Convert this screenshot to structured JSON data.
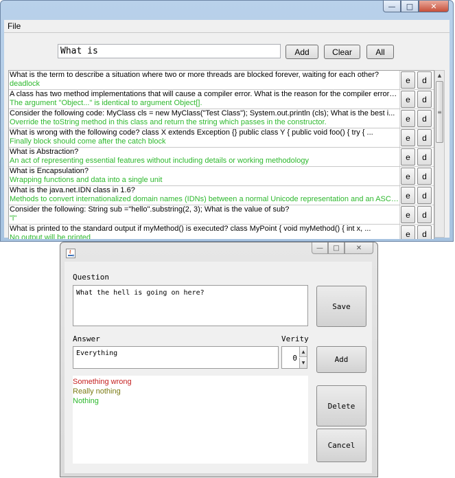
{
  "main_window": {
    "menu": {
      "file": "File"
    },
    "search": {
      "value": "What is"
    },
    "buttons": {
      "add": "Add",
      "clear": "Clear",
      "all": "All"
    },
    "row_buttons": {
      "edit": "e",
      "delete": "d"
    },
    "rows": [
      {
        "question": "What is the term to describe a situation where two or more threads are blocked forever, waiting for each other?",
        "answer": "deadlock"
      },
      {
        "question": "A class has two method implementations that will cause a compiler error. What is the reason for the compiler error? ...",
        "answer": "The argument \"Object...\" is identical to argument Object[]."
      },
      {
        "question": "Consider the following code: MyClass cls = new MyClass(\"Test Class\");  System.out.println (cls);  What is the best i...",
        "answer": "Override the toString method in this class and return the string which passes in the constructor."
      },
      {
        "question": "What is wrong with the following code?  class X extends Exception {} public class Y {     public void foo()     {     try { ...",
        "answer": "Finally block should come after the catch block"
      },
      {
        "question": "What is Abstraction?",
        "answer": "An act of representing essential features without including details or working methodology"
      },
      {
        "question": "What is Encapsulation?",
        "answer": "Wrapping functions and data into a single unit"
      },
      {
        "question": "What is the java.net.IDN class in 1.6?",
        "answer": "Methods to convert internationalized domain names (IDNs) between a normal Unicode representation and an ASCII ..."
      },
      {
        "question": " Consider the following: String sub =\"hello\".substring(2, 3); What is the value of sub?",
        "answer": "\"l\""
      },
      {
        "question": " What is printed to the standard output if myMethod() is executed?  class MyPoint {     void myMethod() {       int x, ...",
        "answer": "No output will be printed"
      }
    ]
  },
  "dialog": {
    "question_label": "Question",
    "question_value": "What the hell is going on here?",
    "answer_label": "Answer",
    "verity_label": "Verity",
    "answer_value": "Everything",
    "verity_value": "0",
    "answers": [
      {
        "text": "Something wrong",
        "color": "#c41f1f"
      },
      {
        "text": "Really nothing",
        "color": "#7a7a14"
      },
      {
        "text": "Nothing",
        "color": "#2db82d"
      }
    ],
    "buttons": {
      "save": "Save",
      "add": "Add",
      "delete": "Delete",
      "cancel": "Cancel"
    }
  }
}
